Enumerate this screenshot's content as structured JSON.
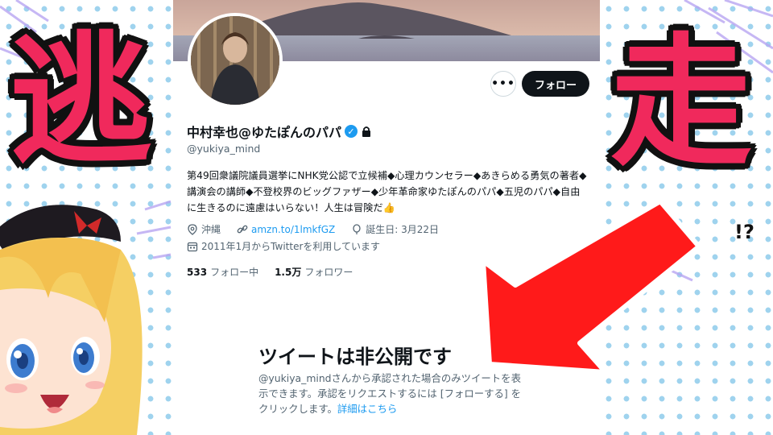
{
  "overlay": {
    "left_char": "逃",
    "right_char": "走",
    "exclaim": "!?"
  },
  "profile": {
    "display_name": "中村幸也@ゆたぽんのパパ",
    "handle": "@yukiya_mind",
    "bio": "第49回衆議院議員選挙にNHK党公認で立候補◆心理カウンセラー◆あきらめる勇気の著者◆講演会の講師◆不登校界のビッグファザー◆少年革命家ゆたぽんのパパ◆五児のパパ◆自由に生きるのに遠慮はいらない！人生は冒険だ👍",
    "location": "沖縄",
    "website": "amzn.to/1lmkfGZ",
    "birthday": "誕生日: 3月22日",
    "joined": "2011年1月からTwitterを利用しています",
    "following_count": "533",
    "following_label": "フォロー中",
    "followers_count": "1.5万",
    "followers_label": "フォロワー",
    "follow_button": "フォロー",
    "more_button": "•••"
  },
  "private_notice": {
    "title": "ツイートは非公開です",
    "description_prefix": "@yukiya_mindさんから承認された場合のみツイートを表示できます。承認をリクエストするには [フォローする] をクリックします。",
    "link": "詳細はこちら"
  },
  "colors": {
    "accent": "#1d9bf0",
    "kanji": "#f0295c",
    "arrow": "#ff1a1a",
    "dots": "#9fd3ee"
  }
}
